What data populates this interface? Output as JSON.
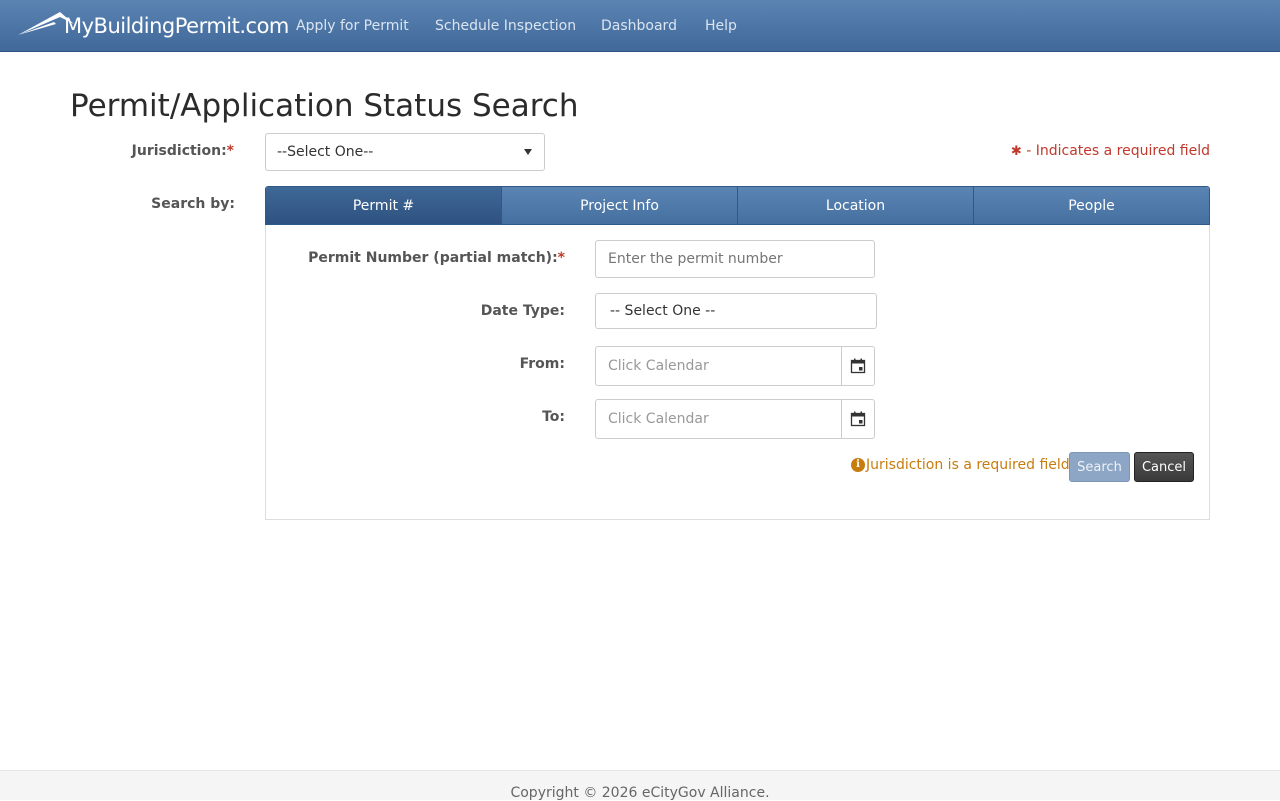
{
  "navbar": {
    "logo_text": "MyBuildingPermit.com",
    "links": [
      "Apply for Permit",
      "Schedule Inspection",
      "Dashboard",
      "Help"
    ]
  },
  "page": {
    "title": "Permit/Application Status Search"
  },
  "jurisdiction": {
    "label": "Jurisdiction:",
    "required_mark": "*",
    "selected": "--Select One--"
  },
  "required_note": "- Indicates a required field",
  "search_by": {
    "label": "Search by:",
    "tabs": [
      {
        "label": "Permit #",
        "active": true
      },
      {
        "label": "Project Info",
        "active": false
      },
      {
        "label": "Location",
        "active": false
      },
      {
        "label": "People",
        "active": false
      }
    ]
  },
  "form": {
    "permit_number": {
      "label": "Permit Number (partial match):",
      "required_mark": "*",
      "placeholder": "Enter the permit number",
      "value": ""
    },
    "date_type": {
      "label": "Date Type:",
      "selected": "-- Select One --"
    },
    "from": {
      "label": "From:",
      "placeholder": "Click Calendar",
      "value": ""
    },
    "to": {
      "label": "To:",
      "placeholder": "Click Calendar",
      "value": ""
    },
    "error_message": "Jurisdiction is a required field",
    "error_icon": "info-icon",
    "calendar_icon": "calendar-icon",
    "search_label": "Search",
    "cancel_label": "Cancel"
  },
  "footer": {
    "copyright": "Copyright © 2026 eCityGov Alliance."
  },
  "colors": {
    "navbar": "#4a73a5",
    "required": "#c0392b",
    "warning": "#c77c0e",
    "tab_active": "#335b88"
  }
}
